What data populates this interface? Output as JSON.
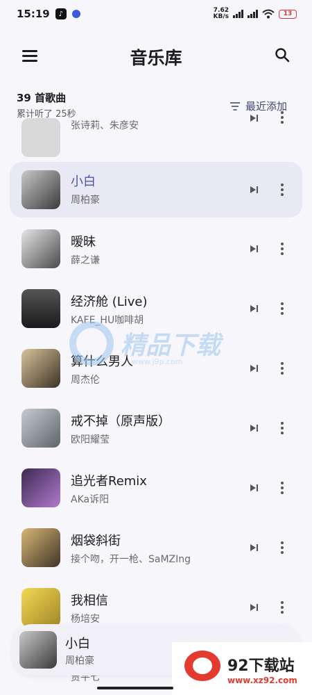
{
  "status_bar": {
    "time": "15:19",
    "net_speed_value": "7.62",
    "net_speed_unit": "KB/s",
    "battery": "13"
  },
  "header": {
    "title": "音乐库"
  },
  "summary": {
    "song_count": "39 首歌曲",
    "listen_time": "累计听了 25秒",
    "sort_label": "最近添加"
  },
  "songs": [
    {
      "title": "",
      "artist": "张诗莉、朱彦安",
      "cover_color": "#d9d9d9"
    },
    {
      "title": "小白",
      "artist": "周柏豪",
      "cover_color": "#6b6b6b",
      "active": true
    },
    {
      "title": "暧昧",
      "artist": "薛之谦",
      "cover_color": "#8a8a8a"
    },
    {
      "title": "经济舱 (Live)",
      "artist": "KAFE_HU咖啡胡",
      "cover_color": "#2d2d2d"
    },
    {
      "title": "算什么男人",
      "artist": "周杰伦",
      "cover_color": "#b5a27a"
    },
    {
      "title": "戒不掉（原声版）",
      "artist": "欧阳耀莹",
      "cover_color": "#9a9ea3"
    },
    {
      "title": "追光者Remix",
      "artist": "AKa诉阳",
      "cover_color": "#8a5fa8"
    },
    {
      "title": "烟袋斜街",
      "artist": "接个吻，开一枪、SaMZIng",
      "cover_color": "#7e6f4e"
    },
    {
      "title": "我相信",
      "artist": "杨培安",
      "cover_color": "#e4c94b"
    }
  ],
  "partial_artist": "贾平七",
  "watermark": {
    "text": "精品下载",
    "url": "www.j9p.com"
  },
  "mini_player": {
    "title": "小白",
    "artist": "周柏豪"
  },
  "promo": {
    "name": "92下载站",
    "url": "www.xz92.com"
  }
}
